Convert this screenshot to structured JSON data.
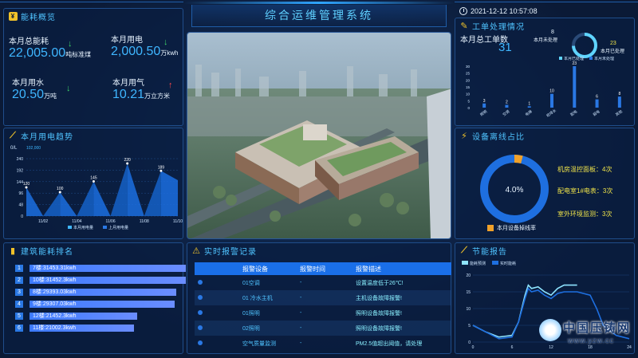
{
  "header": {
    "title": "综合运维管理系统",
    "datetime": "2021-12-12 10:57:08"
  },
  "energy_overview": {
    "title": "能耗概览",
    "total_energy": {
      "label": "本月总能耗",
      "value": "22,005.00",
      "unit": "吨标准煤",
      "trend": "down"
    },
    "electricity": {
      "label": "本月用电",
      "value": "2,000.50",
      "unit": "万kwh",
      "trend": "down"
    },
    "water": {
      "label": "本月用水",
      "value": "20.50",
      "unit": "万吨",
      "trend": "down"
    },
    "gas": {
      "label": "本月用气",
      "value": "10.21",
      "unit": "万立方米",
      "trend": "up"
    }
  },
  "electricity_trend": {
    "title": "本月用电趋势",
    "unit_label": "0/L",
    "legend_top": "102,000",
    "legend": [
      "本月用电量",
      "上月用电量"
    ]
  },
  "work_orders": {
    "title": "工单处理情况",
    "total_label": "本月总工单数",
    "total_value": "31",
    "unprocessed_label": "本月未处理",
    "unprocessed_value": "8",
    "processed_label": "本月已处理",
    "processed_value": "23",
    "legend": [
      "本月已处理",
      "本月未处理"
    ]
  },
  "offline_ratio": {
    "title": "设备离线占比",
    "center_value": "4.0%",
    "legend_label": "本月设备掉线率",
    "items": [
      {
        "label": "机房温控面板：",
        "value": "4次"
      },
      {
        "label": "配电室1#电表：",
        "value": "3次"
      },
      {
        "label": "室外环境监测：",
        "value": "3次"
      }
    ],
    "percent": 4.0
  },
  "building_ranking": {
    "title": "建筑能耗排名",
    "items": [
      {
        "rank": "1",
        "label": "7楼:31453.31kwh",
        "ratio": 1.0
      },
      {
        "rank": "2",
        "label": "10楼:31452.3kwh",
        "ratio": 1.0
      },
      {
        "rank": "3",
        "label": "8楼:29393.03kwh",
        "ratio": 0.94
      },
      {
        "rank": "4",
        "label": "9楼:29307.03kwh",
        "ratio": 0.93
      },
      {
        "rank": "5",
        "label": "12楼:21452.3kwh",
        "ratio": 0.69
      },
      {
        "rank": "6",
        "label": "11楼:21002.3kwh",
        "ratio": 0.67
      }
    ]
  },
  "alarms": {
    "title": "实时报警记录",
    "headers": [
      "报警设备",
      "报警时间",
      "报警描述"
    ],
    "rows": [
      {
        "device": "01空调",
        "time": "-",
        "desc": "设置温度低于26℃!"
      },
      {
        "device": "01 冷水主机",
        "time": "-",
        "desc": "主机设备故障报警!"
      },
      {
        "device": "01照明",
        "time": "-",
        "desc": "照明设备故障报警!"
      },
      {
        "device": "02照明",
        "time": "-",
        "desc": "照明设备故障报警!"
      },
      {
        "device": "空气质量监测",
        "time": "-",
        "desc": "PM2.5值超出阈值，请处理"
      }
    ]
  },
  "energy_report": {
    "title": "节能报告",
    "legend": [
      "能耗预测",
      "实时能耗"
    ]
  },
  "watermark": {
    "text": "中国压铸网",
    "url": "www.yzw.cc"
  },
  "chart_data": [
    {
      "type": "area",
      "title": "本月用电趋势",
      "x": [
        "11/02",
        "11/04",
        "11/06",
        "11/08",
        "11/10"
      ],
      "ylim": [
        0,
        240
      ],
      "yticks": [
        0,
        48,
        96,
        144,
        192,
        240
      ],
      "series": [
        {
          "name": "本月用电量",
          "points": [
            [
              0,
              120
            ],
            [
              1,
              0
            ],
            [
              2,
              100
            ],
            [
              3,
              0
            ],
            [
              4,
              145
            ],
            [
              5,
              0
            ],
            [
              6,
              220
            ],
            [
              7,
              0
            ],
            [
              8,
              189
            ],
            [
              9,
              150
            ]
          ]
        }
      ],
      "labels": [
        120,
        100,
        145,
        220,
        189
      ]
    },
    {
      "type": "bar",
      "title": "工单处理情况",
      "categories": [
        "照明",
        "空调",
        "电梯",
        "给排水",
        "配电",
        "弱电",
        "其他"
      ],
      "series": [
        {
          "name": "本月已处理",
          "values": [
            3,
            2,
            1,
            10,
            30,
            6,
            8
          ]
        },
        {
          "name": "本月未处理",
          "values": [
            0,
            0,
            0,
            0,
            0,
            0,
            0
          ]
        }
      ],
      "value_labels": [
        3,
        2,
        1,
        10,
        23,
        6,
        8
      ],
      "ylim": [
        0,
        30
      ],
      "yticks": [
        0,
        5,
        10,
        15,
        20,
        25,
        30
      ]
    },
    {
      "type": "line",
      "title": "节能报告",
      "x": [
        0,
        6,
        12,
        18,
        24
      ],
      "ylim": [
        0,
        20
      ],
      "yticks": [
        0,
        5,
        10,
        15,
        20
      ],
      "series": [
        {
          "name": "能耗预测",
          "points": [
            [
              0,
              5
            ],
            [
              2,
              3
            ],
            [
              4,
              1.5
            ],
            [
              6,
              2
            ],
            [
              7,
              6
            ],
            [
              8,
              14
            ],
            [
              8.5,
              17
            ],
            [
              9,
              16
            ],
            [
              10,
              16.5
            ],
            [
              11,
              15
            ],
            [
              12,
              14
            ],
            [
              13,
              16
            ],
            [
              14,
              17
            ],
            [
              16,
              17
            ]
          ]
        },
        {
          "name": "实时能耗",
          "points": [
            [
              0,
              5
            ],
            [
              2,
              3
            ],
            [
              4,
              1
            ],
            [
              6,
              1.5
            ],
            [
              7,
              6
            ],
            [
              8,
              13
            ],
            [
              8.5,
              16
            ],
            [
              9,
              15
            ],
            [
              10,
              15.5
            ],
            [
              11,
              14
            ],
            [
              12,
              13
            ],
            [
              13,
              14.5
            ],
            [
              14,
              15
            ],
            [
              16,
              15
            ],
            [
              18,
              14
            ],
            [
              19,
              10
            ],
            [
              20,
              5
            ],
            [
              22,
              2
            ],
            [
              24,
              1
            ]
          ]
        }
      ]
    }
  ]
}
